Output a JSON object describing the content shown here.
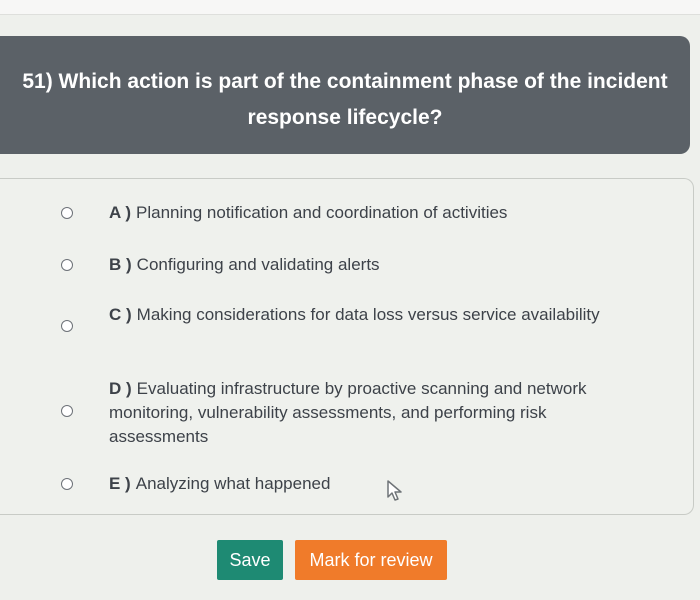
{
  "question": {
    "number_and_text": "51) Which action is part of the containment phase of the incident response lifecycle?"
  },
  "options": [
    {
      "letter": "A )",
      "text": "Planning notification and coordination of activities"
    },
    {
      "letter": "B )",
      "text": "Configuring and validating alerts"
    },
    {
      "letter": "C )",
      "text": "Making considerations for data loss versus service availability"
    },
    {
      "letter": "D )",
      "text": "Evaluating infrastructure by proactive scanning and network monitoring, vulnerability assessments, and performing risk assessments"
    },
    {
      "letter": "E )",
      "text": "Analyzing what happened"
    }
  ],
  "buttons": {
    "save_label": "Save",
    "review_label": "Mark for review"
  },
  "colors": {
    "header_bg": "#5b6167",
    "save_bg": "#1e8a73",
    "review_bg": "#f07b2a"
  },
  "icons": {
    "radio": "radio-unchecked-icon",
    "cursor": "mouse-pointer-icon"
  }
}
